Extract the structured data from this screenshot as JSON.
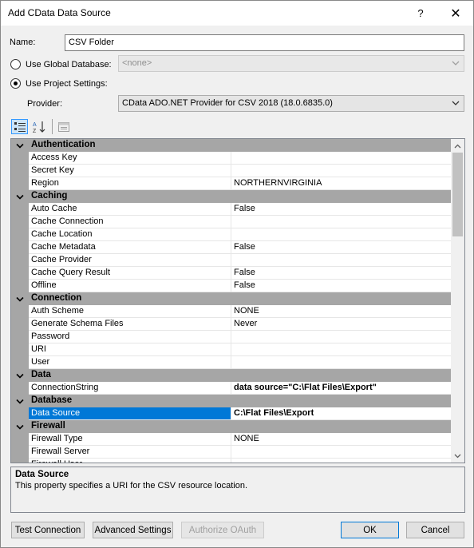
{
  "window": {
    "title": "Add CData Data Source",
    "help_label": "?",
    "close_label": "✕"
  },
  "form": {
    "name_label": "Name:",
    "name_value": "CSV Folder",
    "global_db_label": "Use Global Database:",
    "global_db_value": "<none>",
    "global_db_checked": false,
    "project_settings_label": "Use Project Settings:",
    "project_settings_checked": true,
    "provider_label": "Provider:",
    "provider_value": "CData ADO.NET Provider for CSV 2018 (18.0.6835.0)"
  },
  "toolbar": {
    "categorized_icon": "categorized-icon",
    "alphabetical_icon": "sort-az-icon",
    "property_pages_icon": "property-pages-icon"
  },
  "grid": {
    "categories": [
      {
        "name": "Authentication",
        "properties": [
          {
            "name": "Access Key",
            "value": ""
          },
          {
            "name": "Secret Key",
            "value": ""
          },
          {
            "name": "Region",
            "value": "NORTHERNVIRGINIA"
          }
        ]
      },
      {
        "name": "Caching",
        "properties": [
          {
            "name": "Auto Cache",
            "value": "False"
          },
          {
            "name": "Cache Connection",
            "value": ""
          },
          {
            "name": "Cache Location",
            "value": ""
          },
          {
            "name": "Cache Metadata",
            "value": "False"
          },
          {
            "name": "Cache Provider",
            "value": ""
          },
          {
            "name": "Cache Query Result",
            "value": "False"
          },
          {
            "name": "Offline",
            "value": "False"
          }
        ]
      },
      {
        "name": "Connection",
        "properties": [
          {
            "name": "Auth Scheme",
            "value": "NONE"
          },
          {
            "name": "Generate Schema Files",
            "value": "Never"
          },
          {
            "name": "Password",
            "value": ""
          },
          {
            "name": "URI",
            "value": ""
          },
          {
            "name": "User",
            "value": ""
          }
        ]
      },
      {
        "name": "Data",
        "properties": [
          {
            "name": "ConnectionString",
            "value": "data source=\"C:\\Flat Files\\Export\"",
            "bold": true
          }
        ]
      },
      {
        "name": "Database",
        "properties": [
          {
            "name": "Data Source",
            "value": "C:\\Flat Files\\Export",
            "bold": true,
            "selected": true
          }
        ]
      },
      {
        "name": "Firewall",
        "properties": [
          {
            "name": "Firewall Type",
            "value": "NONE"
          },
          {
            "name": "Firewall Server",
            "value": ""
          },
          {
            "name": "Firewall User",
            "value": ""
          }
        ]
      }
    ]
  },
  "description": {
    "title": "Data Source",
    "text": "This property specifies a URI for the CSV resource location."
  },
  "buttons": {
    "test_connection": "Test Connection",
    "advanced_settings": "Advanced Settings",
    "authorize_oauth": "Authorize OAuth",
    "ok": "OK",
    "cancel": "Cancel"
  },
  "colors": {
    "category_band": "#a6a6a6",
    "selection": "#0078d7",
    "dialog_bg": "#f0f0f0"
  }
}
